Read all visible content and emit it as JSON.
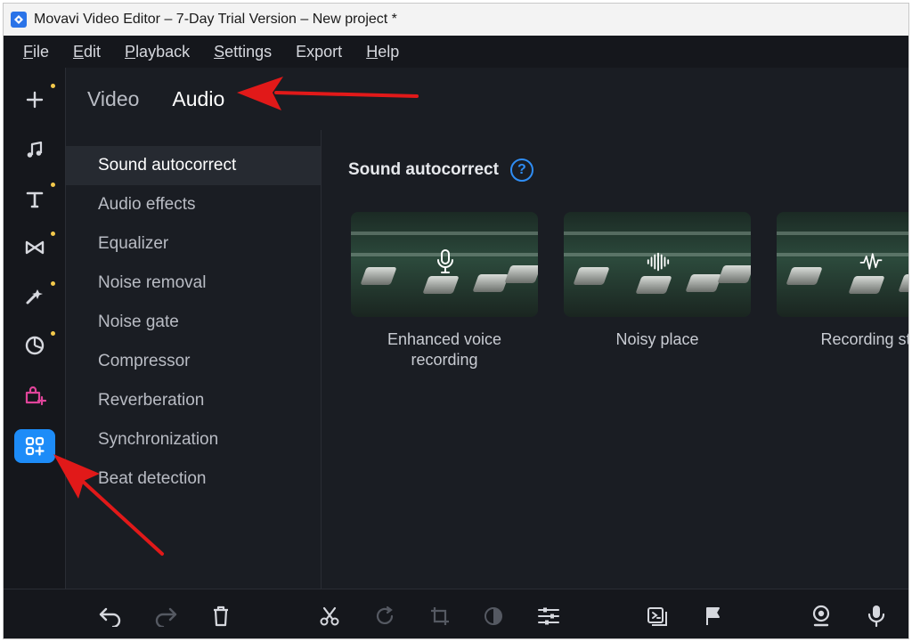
{
  "window": {
    "title": "Movavi Video Editor – 7-Day Trial Version – New project *"
  },
  "menu": [
    {
      "u": "F",
      "rest": "ile"
    },
    {
      "u": "E",
      "rest": "dit"
    },
    {
      "u": "P",
      "rest": "layback"
    },
    {
      "u": "S",
      "rest": "ettings"
    },
    {
      "u": "",
      "rest": "Export"
    },
    {
      "u": "H",
      "rest": "elp"
    }
  ],
  "sidebar": [
    "add-icon",
    "music-icon",
    "titles-icon",
    "transitions-icon",
    "filters-icon",
    "stickers-icon",
    "effects-store-icon",
    "more-tools-icon"
  ],
  "tabs": {
    "video": "Video",
    "audio": "Audio"
  },
  "categories": [
    "Sound autocorrect",
    "Audio effects",
    "Equalizer",
    "Noise removal",
    "Noise gate",
    "Compressor",
    "Reverberation",
    "Synchronization",
    "Beat detection"
  ],
  "section": {
    "title": "Sound autocorrect",
    "help": "?"
  },
  "presets": [
    {
      "line1": "Enhanced voice",
      "line2": "recording",
      "icon": "microphone-icon"
    },
    {
      "line1": "Noisy place",
      "line2": "",
      "icon": "waveform-icon"
    },
    {
      "line1": "Recording stu",
      "line2": "",
      "icon": "audio-wave-icon"
    }
  ],
  "colors": {
    "accent": "#1d8cf8",
    "annotation_arrow": "#e11919",
    "dot": "#f3c94b"
  }
}
